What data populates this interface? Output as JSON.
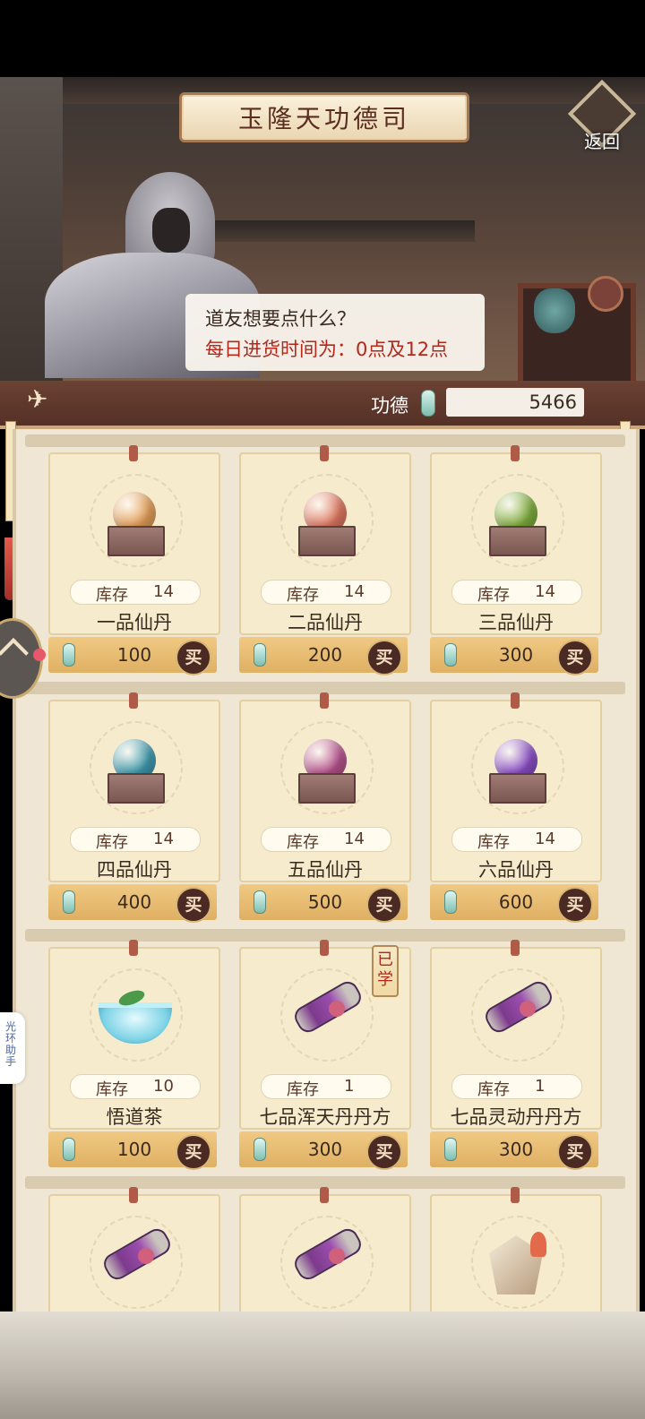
{
  "header": {
    "title": "玉隆天功德司",
    "back_label": "返回"
  },
  "npc": {
    "speech_line1": "道友想要点什么？",
    "speech_line2": "每日进货时间为：0点及12点"
  },
  "merit": {
    "label": "功德",
    "value": "5466"
  },
  "helper": {
    "label": "光环助手"
  },
  "shop": {
    "stock_label": "库存",
    "buy_label": "买",
    "learned_label": "已学",
    "items": [
      {
        "name": "一品仙丹",
        "stock": "14",
        "price": "100",
        "orb_color": "#e6a05a"
      },
      {
        "name": "二品仙丹",
        "stock": "14",
        "price": "200",
        "orb_color": "#e07862"
      },
      {
        "name": "三品仙丹",
        "stock": "14",
        "price": "300",
        "orb_color": "#7fae3e"
      },
      {
        "name": "四品仙丹",
        "stock": "14",
        "price": "400",
        "orb_color": "#3f9bb0"
      },
      {
        "name": "五品仙丹",
        "stock": "14",
        "price": "500",
        "orb_color": "#b8538f"
      },
      {
        "name": "六品仙丹",
        "stock": "14",
        "price": "600",
        "orb_color": "#8b4ec8"
      },
      {
        "name": "悟道茶",
        "stock": "10",
        "price": "100"
      },
      {
        "name": "七品浑天丹丹方",
        "stock": "1",
        "price": "300"
      },
      {
        "name": "七品灵动丹丹方",
        "stock": "1",
        "price": "300"
      }
    ]
  },
  "icons": {
    "back": "back-arrow-icon",
    "merit": "jade-gem-icon",
    "crane": "crane-icon",
    "float": "floating-menu-icon"
  },
  "colors": {
    "accent_red": "#b3281b",
    "buy_button": "#4a2a22",
    "price_bar": "#deb063"
  }
}
